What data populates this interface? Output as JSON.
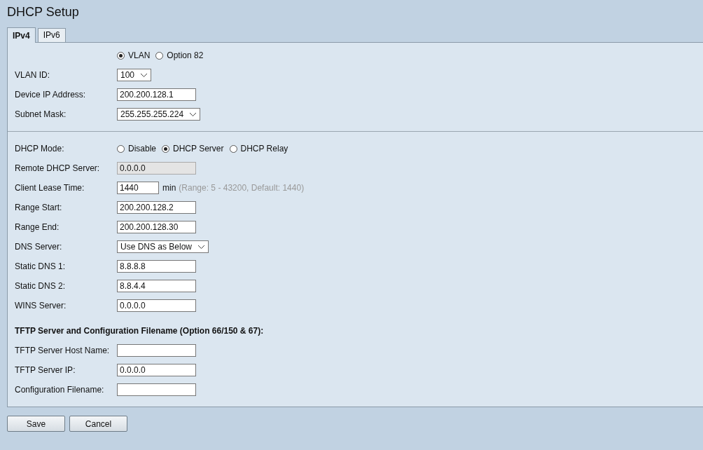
{
  "title": "DHCP Setup",
  "tabs": [
    {
      "label": "IPv4",
      "selected": true
    },
    {
      "label": "IPv6",
      "selected": false
    }
  ],
  "sections": [
    {
      "rows": [
        {
          "kind": "radio",
          "options": [
            {
              "label": "VLAN",
              "selected": true
            },
            {
              "label": "Option 82",
              "selected": false
            }
          ]
        },
        {
          "kind": "select",
          "label": "VLAN ID:",
          "value": "100"
        },
        {
          "kind": "input",
          "label": "Device IP Address:",
          "value": "200.200.128.1",
          "disabled": false
        },
        {
          "kind": "select",
          "label": "Subnet Mask:",
          "value": "255.255.255.224"
        }
      ]
    },
    {
      "rows": [
        {
          "kind": "radio",
          "label": "DHCP Mode:",
          "options": [
            {
              "label": "Disable",
              "selected": false
            },
            {
              "label": "DHCP Server",
              "selected": true
            },
            {
              "label": "DHCP Relay",
              "selected": false
            }
          ]
        },
        {
          "kind": "input",
          "label": "Remote DHCP Server:",
          "value": "0.0.0.0",
          "disabled": true
        },
        {
          "kind": "input",
          "label": "Client Lease Time:",
          "value": "1440",
          "disabled": false,
          "unit": "min",
          "hint": "(Range: 5 - 43200, Default: 1440)"
        },
        {
          "kind": "input",
          "label": "Range Start:",
          "value": "200.200.128.2",
          "disabled": false
        },
        {
          "kind": "input",
          "label": "Range End:",
          "value": "200.200.128.30",
          "disabled": false
        },
        {
          "kind": "select",
          "label": "DNS Server:",
          "value": "Use DNS as Below"
        },
        {
          "kind": "input",
          "label": "Static DNS 1:",
          "value": "8.8.8.8",
          "disabled": false
        },
        {
          "kind": "input",
          "label": "Static DNS 2:",
          "value": "8.8.4.4",
          "disabled": false
        },
        {
          "kind": "input",
          "label": "WINS Server:",
          "value": "0.0.0.0",
          "disabled": false
        },
        {
          "kind": "heading",
          "label": "TFTP Server and Configuration Filename (Option 66/150 & 67):"
        },
        {
          "kind": "input",
          "label": "TFTP Server Host Name:",
          "disabled": false
        },
        {
          "kind": "input",
          "label": "TFTP Server IP:",
          "value": "0.0.0.0",
          "disabled": false
        },
        {
          "kind": "input",
          "label": "Configuration Filename:",
          "disabled": false
        }
      ]
    }
  ],
  "buttons": [
    "Save",
    "Cancel"
  ]
}
